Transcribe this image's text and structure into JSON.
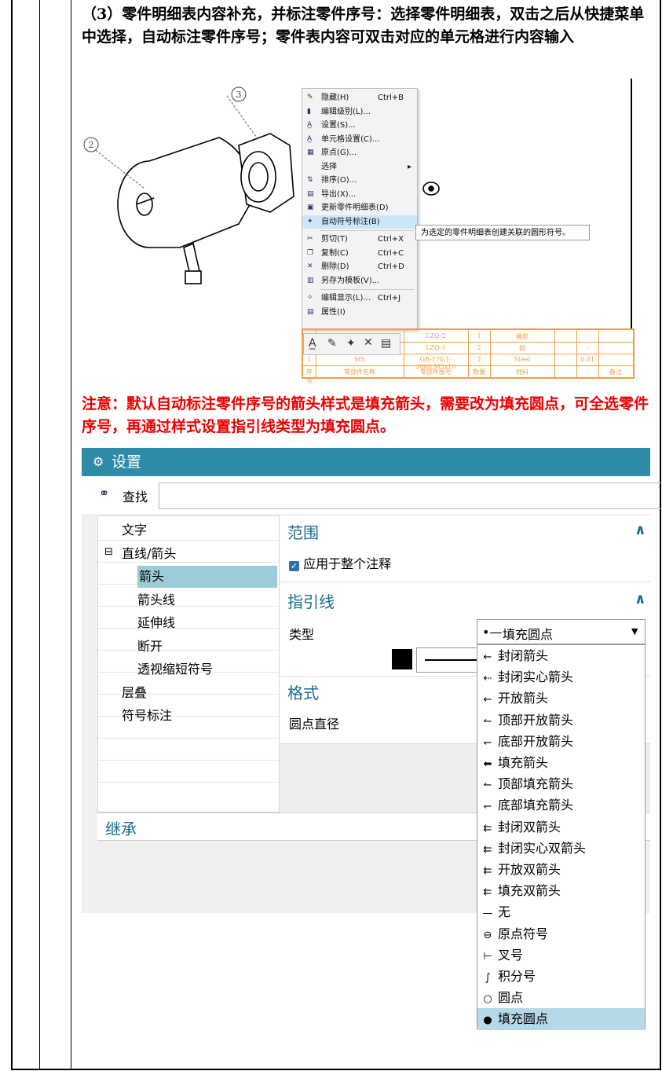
{
  "paragraph_1": "（3）零件明细表内容补充，并标注零件序号：选择零件明细表，双击之后从快捷菜单中选择，自动标注零件序号；零件表内容可双击对应的单元格进行内容输入",
  "note": "注意：默认自动标注零件序号的箭头样式是填充箭头，需要改为填充圆点，可全选零件序号，再通过样式设置指引线类型为填充圆点。",
  "drawing": {
    "callouts": [
      "3",
      "2"
    ],
    "context_menu": [
      {
        "icon": "hide-icon",
        "label": "隐藏(H)",
        "shortcut": "Ctrl+B"
      },
      {
        "icon": "edit-level-icon",
        "label": "编辑级别(L)...",
        "shortcut": ""
      },
      {
        "icon": "settings-icon",
        "label": "设置(S)...",
        "shortcut": ""
      },
      {
        "icon": "cell-settings-icon",
        "label": "单元格设置(C)...",
        "shortcut": ""
      },
      {
        "icon": "origin-icon",
        "label": "原点(G)...",
        "shortcut": ""
      },
      {
        "icon": "",
        "label": "选择",
        "shortcut": "▸"
      },
      {
        "icon": "sort-icon",
        "label": "排序(O)...",
        "shortcut": ""
      },
      {
        "icon": "export-icon",
        "label": "导出(X)...",
        "shortcut": ""
      },
      {
        "icon": "update-bom-icon",
        "label": "更新零件明细表(D)",
        "shortcut": ""
      },
      {
        "icon": "auto-balloon-icon",
        "label": "自动符号标注(B)",
        "shortcut": ""
      },
      {
        "icon": "cut-icon",
        "label": "剪切(T)",
        "shortcut": "Ctrl+X"
      },
      {
        "icon": "copy-icon",
        "label": "复制(C)",
        "shortcut": "Ctrl+C"
      },
      {
        "icon": "delete-icon",
        "label": "删除(D)",
        "shortcut": "Ctrl+D"
      },
      {
        "icon": "save-template-icon",
        "label": "另存为模板(V)...",
        "shortcut": ""
      },
      {
        "icon": "edit-display-icon",
        "label": "编辑显示(L)...",
        "shortcut": "Ctrl+J"
      },
      {
        "icon": "properties-icon",
        "label": "属性(I)",
        "shortcut": ""
      }
    ],
    "tooltip": "为选定的零件明细表创建关联的圆形符号。",
    "bom_rows": [
      [
        "",
        "",
        "LZQ-2",
        "1",
        "橡胶",
        "",
        "-",
        ""
      ],
      [
        "",
        "",
        "LZQ-1",
        "2",
        "钢",
        "",
        "-",
        ""
      ],
      [
        "1",
        "M5",
        "GB-T70.1-2000,M5x16",
        "2",
        "Steel",
        "",
        "0.01",
        ""
      ],
      [
        "序号",
        "零部件名称",
        "零部件图号",
        "数量",
        "材料",
        "",
        "",
        "备注"
      ]
    ]
  },
  "dialog": {
    "title": "设置",
    "search_label": "查找",
    "tree": [
      {
        "label": "文字",
        "level": 1
      },
      {
        "label": "直线/箭头",
        "level": 1,
        "expanded": true
      },
      {
        "label": "箭头",
        "level": 2,
        "selected": true
      },
      {
        "label": "箭头线",
        "level": 2
      },
      {
        "label": "延伸线",
        "level": 2
      },
      {
        "label": "断开",
        "level": 2
      },
      {
        "label": "透视缩短符号",
        "level": 2
      },
      {
        "label": "层叠",
        "level": 1
      },
      {
        "label": "符号标注",
        "level": 1
      }
    ],
    "section_scope": "范围",
    "apply_all": "应用于整个注释",
    "section_leader": "指引线",
    "type_label": "类型",
    "type_value": "填充圆点",
    "section_format": "格式",
    "dot_diameter": "圆点直径",
    "inherit": "继承",
    "dropdown": [
      {
        "glyph": "←",
        "label": "封闭箭头"
      },
      {
        "glyph": "⇠",
        "label": "封闭实心箭头"
      },
      {
        "glyph": "←",
        "label": "开放箭头"
      },
      {
        "glyph": "↼",
        "label": "顶部开放箭头"
      },
      {
        "glyph": "↽",
        "label": "底部开放箭头"
      },
      {
        "glyph": "⬅",
        "label": "填充箭头"
      },
      {
        "glyph": "↼",
        "label": "顶部填充箭头"
      },
      {
        "glyph": "↽",
        "label": "底部填充箭头"
      },
      {
        "glyph": "⇇",
        "label": "封闭双箭头"
      },
      {
        "glyph": "⇇",
        "label": "封闭实心双箭头"
      },
      {
        "glyph": "⇇",
        "label": "开放双箭头"
      },
      {
        "glyph": "⇇",
        "label": "填充双箭头"
      },
      {
        "glyph": "—",
        "label": "无"
      },
      {
        "glyph": "⊖",
        "label": "原点符号"
      },
      {
        "glyph": "⊢",
        "label": "叉号"
      },
      {
        "glyph": "∫",
        "label": "积分号"
      },
      {
        "glyph": "○",
        "label": "圆点"
      },
      {
        "glyph": "●",
        "label": "填充圆点",
        "selected": true
      }
    ]
  }
}
